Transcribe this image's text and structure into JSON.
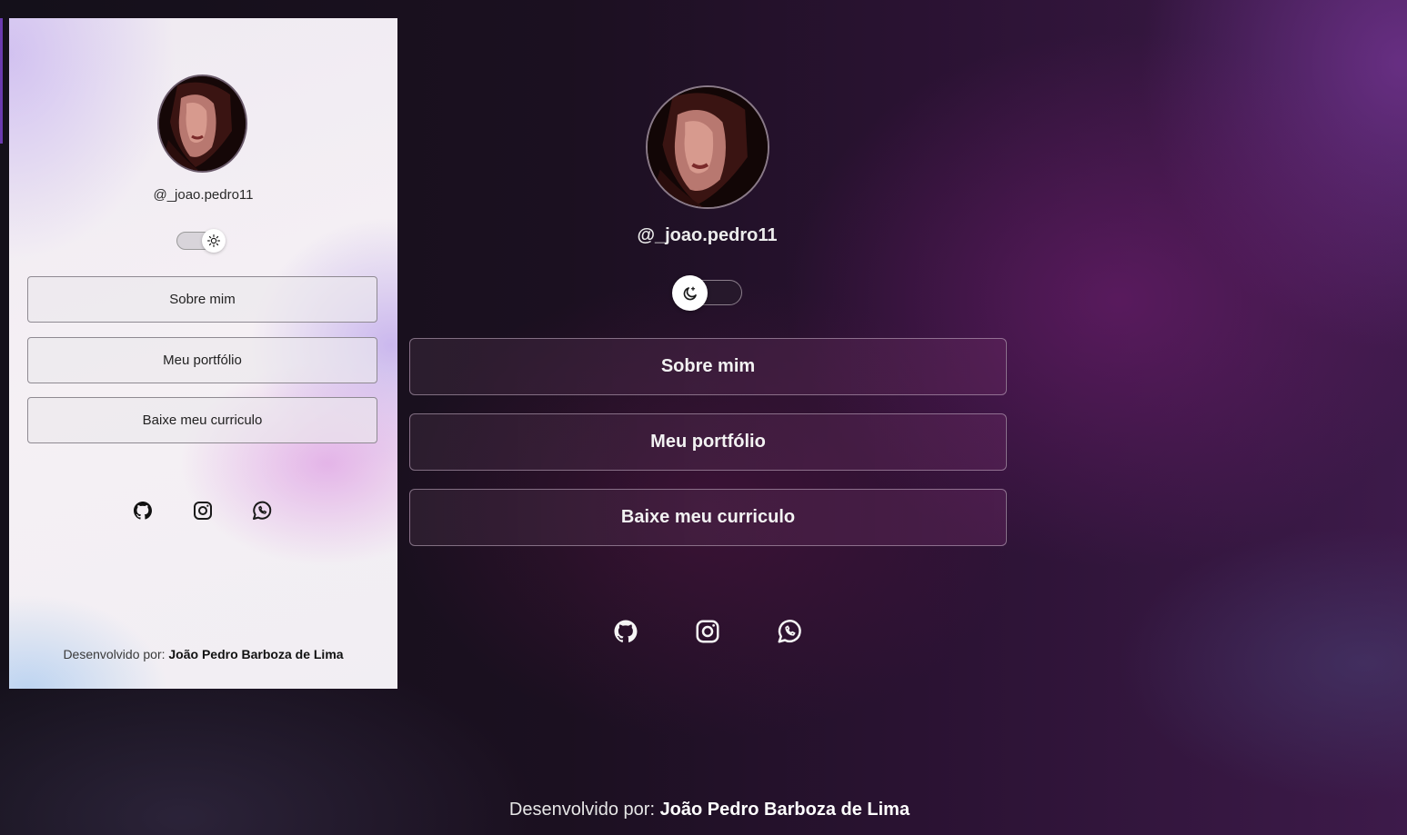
{
  "handle": "@_joao.pedro11",
  "buttons": {
    "about": "Sobre mim",
    "portfolio": "Meu portfólio",
    "resume": "Baixe meu curriculo"
  },
  "footer": {
    "prefix": "Desenvolvido por:",
    "author": "João Pedro Barboza de Lima"
  },
  "icons": {
    "avatar": "avatar-photo",
    "theme_light": "sun-icon",
    "theme_dark": "moon-icon",
    "github": "github-icon",
    "instagram": "instagram-icon",
    "whatsapp": "whatsapp-icon"
  },
  "theme": {
    "light_preview": {
      "toggle_state": "light"
    },
    "dark_page": {
      "toggle_state": "dark"
    }
  },
  "colors": {
    "dark_background": "#1b1020",
    "accent_purple": "#5a2a6e",
    "light_background": "#f3eff4"
  }
}
